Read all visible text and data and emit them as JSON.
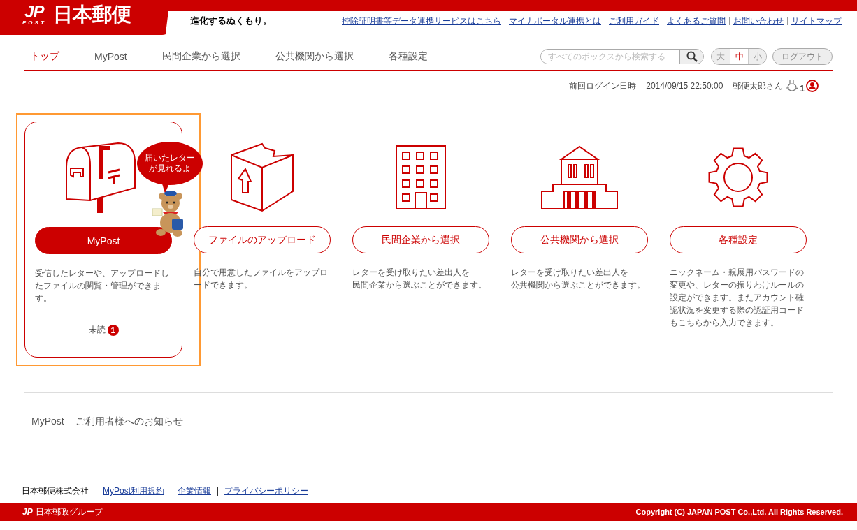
{
  "header": {
    "logo_mark": "JP",
    "logo_sub": "POST",
    "logo_text": "日本郵便",
    "tagline": "進化するぬくもり。",
    "links": [
      "控除証明書等データ連携サービスはこちら",
      "マイナポータル連携とは",
      "ご利用ガイド",
      "よくあるご質問",
      "お問い合わせ",
      "サイトマップ"
    ]
  },
  "nav": {
    "tabs": [
      {
        "label": "トップ",
        "selected": true
      },
      {
        "label": "MyPost",
        "selected": false
      },
      {
        "label": "民間企業から選択",
        "selected": false
      },
      {
        "label": "公共機関から選択",
        "selected": false
      },
      {
        "label": "各種設定",
        "selected": false
      }
    ],
    "search": {
      "placeholder": "すべてのボックスから検索する"
    },
    "font_sizes": [
      {
        "label": "大",
        "selected": false
      },
      {
        "label": "中",
        "selected": true
      },
      {
        "label": "小",
        "selected": false
      }
    ],
    "logout": "ログアウト"
  },
  "login_info": {
    "label": "前回ログイン日時",
    "datetime": "2014/09/15 22:50:00",
    "user": "郵便太郎さん",
    "notification_count": "1"
  },
  "cards": [
    {
      "kind": "mailbox",
      "button": "MyPost",
      "highlighted": true,
      "description": [
        "受信したレターや、アップロードし",
        "たファイルの閲覧・管理ができま",
        "す。"
      ],
      "unread_label": "未読",
      "unread_count": "1",
      "bubble": [
        "届いたレター",
        "が見れるよ"
      ]
    },
    {
      "kind": "upload",
      "button": "ファイルのアップロード",
      "highlighted": false,
      "description": [
        "自分で用意したファイルをアップロ",
        "ードできます。"
      ]
    },
    {
      "kind": "company",
      "button": "民間企業から選択",
      "highlighted": false,
      "description": [
        "レターを受け取りたい差出人を",
        "民間企業から選ぶことができます。"
      ]
    },
    {
      "kind": "public",
      "button": "公共機関から選択",
      "highlighted": false,
      "description": [
        "レターを受け取りたい差出人を",
        "公共機関から選ぶことができます。"
      ]
    },
    {
      "kind": "settings",
      "button": "各種設定",
      "highlighted": false,
      "description": [
        "ニックネーム・親展用パスワードの",
        "変更や、レターの振りわけルールの",
        "設定ができます。またアカウント確",
        "認状況を変更する際の認証用コード",
        "もこちらから入力できます。"
      ]
    }
  ],
  "notice": {
    "service": "MyPost",
    "title": "ご利用者様へのお知らせ"
  },
  "footer": {
    "company": "日本郵便株式会社",
    "links": [
      "MyPost利用規約",
      "企業情報",
      "プライバシーポリシー"
    ],
    "group_mark": "JP",
    "group_name": "日本郵政グループ",
    "copyright": "Copyright (C) JAPAN POST Co.,Ltd. All Rights Reserved."
  }
}
